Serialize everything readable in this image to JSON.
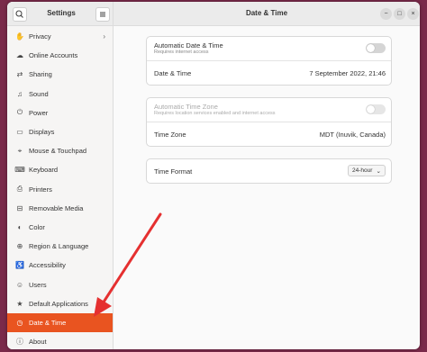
{
  "sidebar": {
    "title": "Settings",
    "items": [
      {
        "label": "Privacy",
        "icon": "hand-icon",
        "glyph": "✋",
        "chevron": true
      },
      {
        "label": "Online Accounts",
        "icon": "cloud-icon",
        "glyph": "☁"
      },
      {
        "label": "Sharing",
        "icon": "share-icon",
        "glyph": "⇄"
      },
      {
        "label": "Sound",
        "icon": "music-note-icon",
        "glyph": "♫"
      },
      {
        "label": "Power",
        "icon": "power-icon",
        "glyph": "⏻"
      },
      {
        "label": "Displays",
        "icon": "monitor-icon",
        "glyph": "▭"
      },
      {
        "label": "Mouse & Touchpad",
        "icon": "mouse-icon",
        "glyph": "⌖"
      },
      {
        "label": "Keyboard",
        "icon": "keyboard-icon",
        "glyph": "⌨"
      },
      {
        "label": "Printers",
        "icon": "printer-icon",
        "glyph": "⎙"
      },
      {
        "label": "Removable Media",
        "icon": "media-icon",
        "glyph": "⊟"
      },
      {
        "label": "Color",
        "icon": "palette-icon",
        "glyph": "◐"
      },
      {
        "label": "Region & Language",
        "icon": "globe-icon",
        "glyph": "⊕"
      },
      {
        "label": "Accessibility",
        "icon": "accessibility-icon",
        "glyph": "♿"
      },
      {
        "label": "Users",
        "icon": "user-icon",
        "glyph": "☺"
      },
      {
        "label": "Default Applications",
        "icon": "star-icon",
        "glyph": "★"
      },
      {
        "label": "Date & Time",
        "icon": "clock-icon",
        "glyph": "◷",
        "active": true
      },
      {
        "label": "About",
        "icon": "info-icon",
        "glyph": "ⓘ"
      }
    ]
  },
  "main": {
    "title": "Date & Time",
    "auto_datetime": {
      "label": "Automatic Date & Time",
      "sub": "Requires internet access"
    },
    "datetime": {
      "label": "Date & Time",
      "value": "7 September 2022, 21:46"
    },
    "auto_timezone": {
      "label": "Automatic Time Zone",
      "sub": "Requires location services enabled and internet access"
    },
    "timezone": {
      "label": "Time Zone",
      "value": "MDT (Inuvik, Canada)"
    },
    "time_format": {
      "label": "Time Format",
      "value": "24-hour"
    }
  },
  "colors": {
    "accent": "#e95420",
    "annotation_arrow": "#e53030",
    "desktop": "#7a2a4a"
  }
}
